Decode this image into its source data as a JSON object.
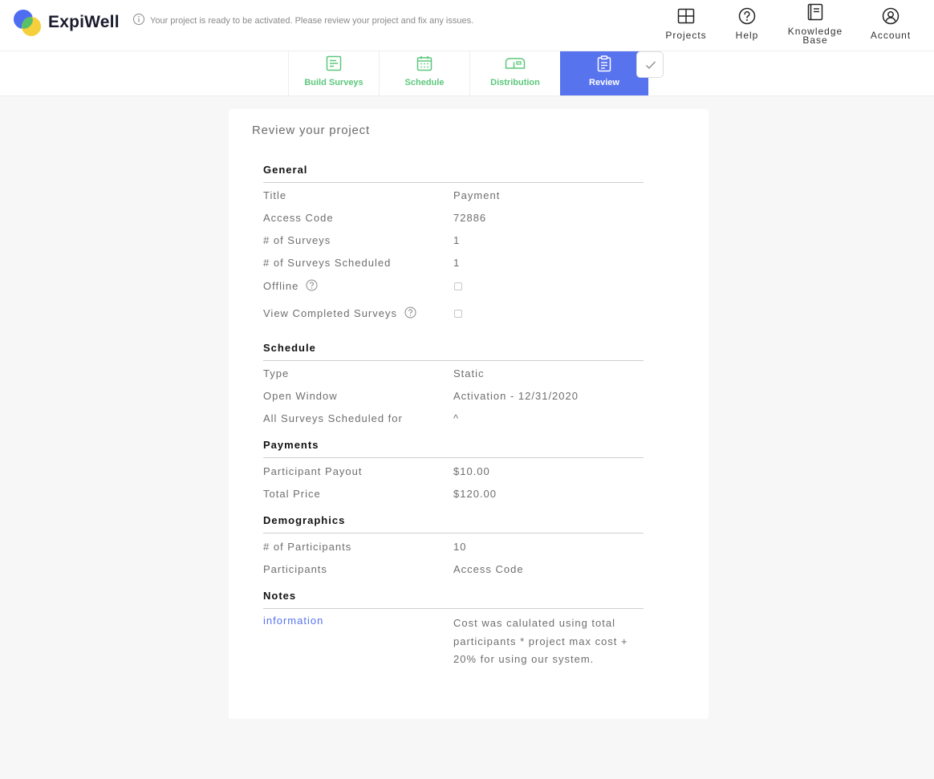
{
  "app": {
    "brand": "ExpiWell",
    "notice": "Your project is ready to be activated. Please review your project and fix any issues."
  },
  "nav": [
    {
      "label": "Projects",
      "icon": "grid-icon"
    },
    {
      "label": "Help",
      "icon": "question-circle-icon"
    },
    {
      "label_line1": "Knowledge",
      "label_line2": "Base",
      "icon": "book-icon"
    },
    {
      "label": "Account",
      "icon": "user-circle-icon"
    }
  ],
  "tabs": [
    {
      "label": "Build Surveys",
      "icon": "form-icon"
    },
    {
      "label": "Schedule",
      "icon": "calendar-icon"
    },
    {
      "label": "Distribution",
      "icon": "mailbox-icon"
    },
    {
      "label": "Review",
      "icon": "clipboard-icon",
      "active": true
    }
  ],
  "review": {
    "title": "Review your project",
    "general": {
      "heading": "General",
      "title_label": "Title",
      "title_value": "Payment",
      "access_label": "Access Code",
      "access_value": "72886",
      "surveys_label": "# of Surveys",
      "surveys_value": "1",
      "scheduled_label": "# of Surveys Scheduled",
      "scheduled_value": "1",
      "offline_label": "Offline",
      "offline_checked": false,
      "view_completed_label": "View Completed Surveys",
      "view_completed_checked": false
    },
    "schedule": {
      "heading": "Schedule",
      "type_label": "Type",
      "type_value": "Static",
      "window_label": "Open Window",
      "window_value": "Activation - 12/31/2020",
      "all_label": "All Surveys Scheduled for",
      "all_value": "^"
    },
    "payments": {
      "heading": "Payments",
      "payout_label": "Participant Payout",
      "payout_value": "$10.00",
      "total_label": "Total Price",
      "total_value": "$120.00"
    },
    "demographics": {
      "heading": "Demographics",
      "count_label": "# of Participants",
      "count_value": "10",
      "participants_label": "Participants",
      "participants_value": "Access Code"
    },
    "notes": {
      "heading": "Notes",
      "info_label": "information",
      "info_value": "Cost was calulated using total participants * project max cost + 20% for using our system."
    }
  },
  "colors": {
    "accent_blue": "#5873ee",
    "step_green": "#5cc77c",
    "logo_blue": "#4f6df0",
    "logo_yellow": "#f5cf3c",
    "logo_green": "#4fbf6c"
  }
}
